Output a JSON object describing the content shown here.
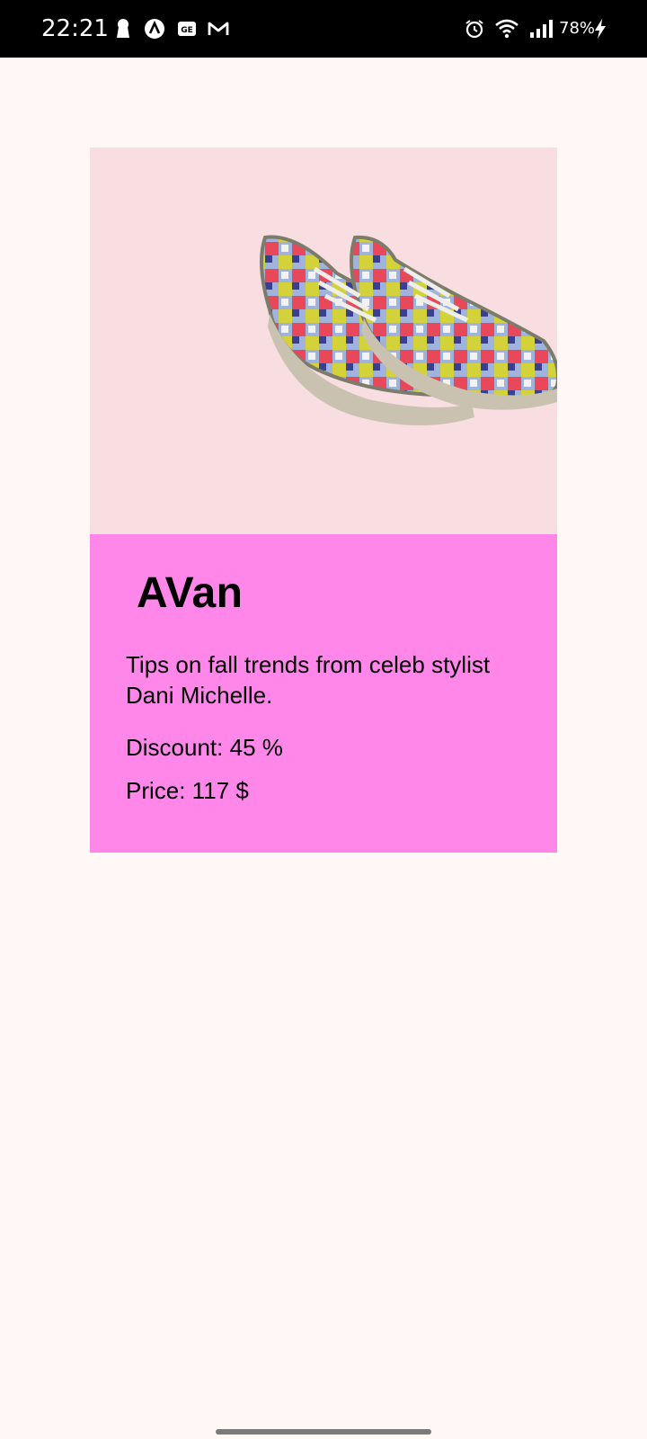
{
  "status_bar": {
    "time": "22:21",
    "battery_text": "78%",
    "left_icons": [
      "keyhole-icon",
      "app-a-icon",
      "ge-icon",
      "gmail-icon"
    ],
    "right_icons": [
      "alarm-icon",
      "wifi-icon",
      "signal-icon",
      "charging-icon"
    ]
  },
  "product": {
    "image": "sneakers-image",
    "name": "AVan",
    "description": "Tips on fall trends from celeb stylist Dani Michelle.",
    "discount_text": "Discount: 45 %",
    "price_text": "Price: 117 $"
  },
  "colors": {
    "page_background": "#fff8f7",
    "image_background": "#f8dde1",
    "card_background": "#ff87ea",
    "status_bar": "#000000"
  }
}
